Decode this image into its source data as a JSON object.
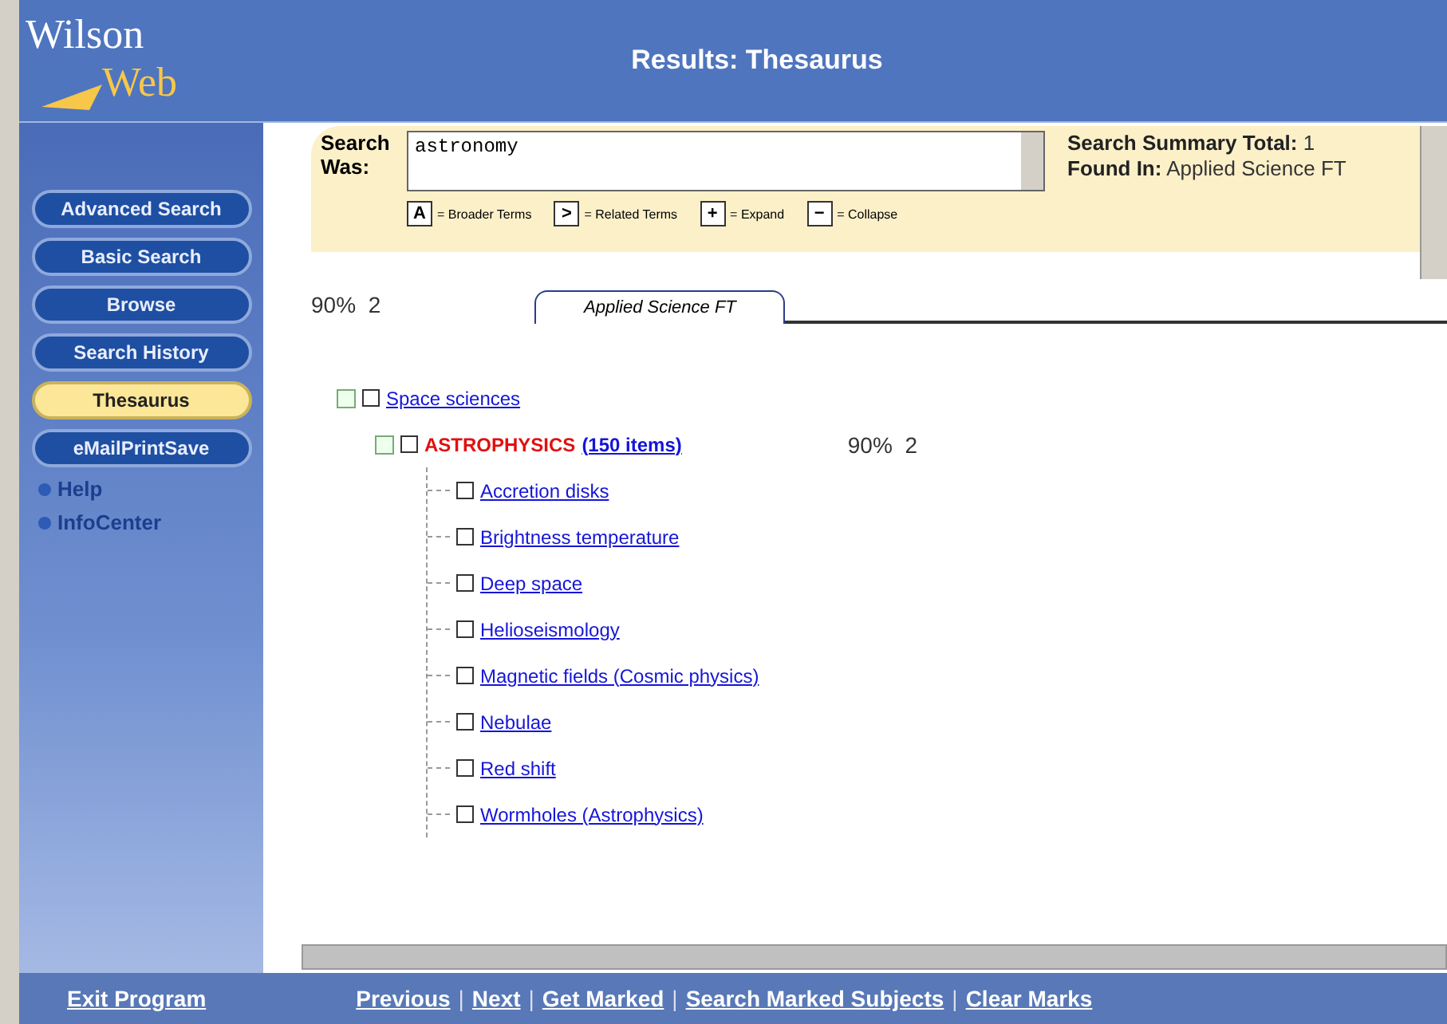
{
  "header": {
    "logo_top": "Wilson",
    "logo_bottom": "Web",
    "title": "Results: Thesaurus"
  },
  "sidebar": {
    "buttons": [
      {
        "label": "Advanced Search",
        "selected": false
      },
      {
        "label": "Basic Search",
        "selected": false
      },
      {
        "label": "Browse",
        "selected": false
      },
      {
        "label": "Search History",
        "selected": false
      },
      {
        "label": "Thesaurus",
        "selected": true
      },
      {
        "label": "eMailPrintSave",
        "selected": false
      }
    ],
    "links": [
      "Help",
      "InfoCenter"
    ]
  },
  "search_panel": {
    "label": "Search Was:",
    "value": "astronomy",
    "summary_label": "Search Summary Total:",
    "summary_total": "1",
    "found_label": "Found In:",
    "found_value": "Applied Science FT",
    "legend": [
      {
        "key": "A",
        "text": "= Broader Terms"
      },
      {
        "key": ">",
        "text": "= Related Terms"
      },
      {
        "key": "+",
        "text": "= Expand"
      },
      {
        "key": "−",
        "text": "= Collapse"
      }
    ]
  },
  "summary_row": {
    "score": "90%",
    "hits": "2"
  },
  "tabs": [
    {
      "label": "Applied Science FT",
      "selected": true
    }
  ],
  "tree": [
    {
      "term": "Space sciences",
      "checked": false,
      "expanded": true,
      "highlighted": false,
      "children": [
        {
          "term": "ASTROPHYSICS",
          "count": "(150 items)",
          "score": "90%",
          "hits": "2",
          "checked": false,
          "expanded": true,
          "highlighted": true,
          "children": [
            {
              "term": "Accretion disks",
              "checked": false,
              "highlighted": false
            },
            {
              "term": "Brightness temperature",
              "checked": false,
              "highlighted": false
            },
            {
              "term": "Deep space",
              "checked": false,
              "highlighted": false
            },
            {
              "term": "Helioseismology",
              "checked": false,
              "highlighted": false
            },
            {
              "term": "Magnetic fields (Cosmic physics)",
              "checked": false,
              "highlighted": false
            },
            {
              "term": "Nebulae",
              "checked": false,
              "highlighted": false
            },
            {
              "term": "Red shift",
              "checked": false,
              "highlighted": false
            },
            {
              "term": "Wormholes (Astrophysics)",
              "checked": false,
              "highlighted": false
            }
          ]
        }
      ]
    }
  ],
  "footer": {
    "exit": "Exit Program",
    "links": [
      "Previous",
      "Next",
      "Get Marked",
      "Search Marked Subjects",
      "Clear Marks"
    ],
    "separators": [
      "|",
      "|",
      "|",
      "|"
    ]
  }
}
